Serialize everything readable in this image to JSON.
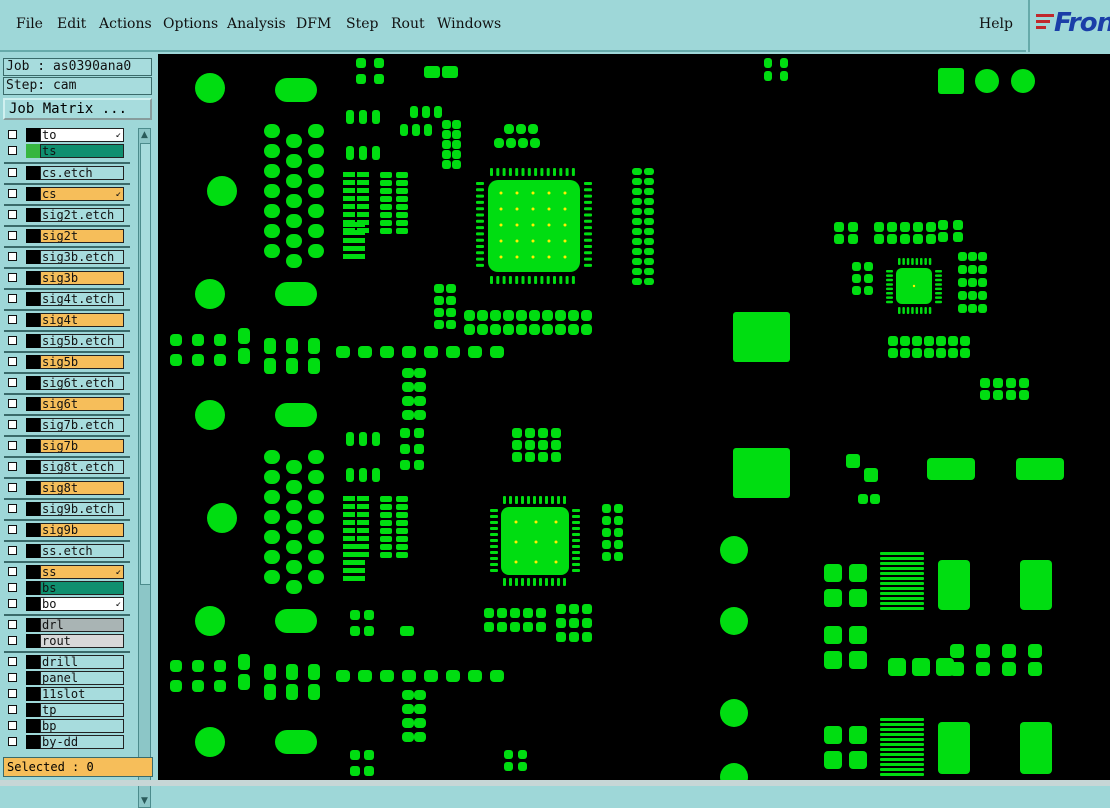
{
  "menu": {
    "items": [
      "File",
      "Edit",
      "Actions",
      "Options",
      "Analysis",
      "DFM",
      "Step",
      "Rout",
      "Windows"
    ],
    "help": "Help"
  },
  "logo": {
    "text": "Fron"
  },
  "info": {
    "job": "Job : as0390ana0",
    "step": "Step: cam"
  },
  "job_matrix_button": "Job Matrix ...",
  "layers": [
    {
      "name": "to",
      "color": "#ffffff",
      "swatch": "#000000",
      "arrow": true
    },
    {
      "name": "ts",
      "color": "#0f8f6f",
      "swatch": "#36b640",
      "arrow": false
    },
    {
      "name": "cs.etch",
      "color": "#a7dcdd",
      "swatch": "#000000",
      "arrow": false
    },
    {
      "name": "cs",
      "color": "#f6be5a",
      "swatch": "#000000",
      "arrow": true
    },
    {
      "name": "sig2t.etch",
      "color": "#a7dcdd",
      "swatch": "#000000",
      "arrow": false
    },
    {
      "name": "sig2t",
      "color": "#f6be5a",
      "swatch": "#000000",
      "arrow": false
    },
    {
      "name": "sig3b.etch",
      "color": "#a7dcdd",
      "swatch": "#000000",
      "arrow": false
    },
    {
      "name": "sig3b",
      "color": "#f6be5a",
      "swatch": "#000000",
      "arrow": false
    },
    {
      "name": "sig4t.etch",
      "color": "#a7dcdd",
      "swatch": "#000000",
      "arrow": false
    },
    {
      "name": "sig4t",
      "color": "#f6be5a",
      "swatch": "#000000",
      "arrow": false
    },
    {
      "name": "sig5b.etch",
      "color": "#a7dcdd",
      "swatch": "#000000",
      "arrow": false
    },
    {
      "name": "sig5b",
      "color": "#f6be5a",
      "swatch": "#000000",
      "arrow": false
    },
    {
      "name": "sig6t.etch",
      "color": "#a7dcdd",
      "swatch": "#000000",
      "arrow": false
    },
    {
      "name": "sig6t",
      "color": "#f6be5a",
      "swatch": "#000000",
      "arrow": false
    },
    {
      "name": "sig7b.etch",
      "color": "#a7dcdd",
      "swatch": "#000000",
      "arrow": false
    },
    {
      "name": "sig7b",
      "color": "#f6be5a",
      "swatch": "#000000",
      "arrow": false
    },
    {
      "name": "sig8t.etch",
      "color": "#a7dcdd",
      "swatch": "#000000",
      "arrow": false
    },
    {
      "name": "sig8t",
      "color": "#f6be5a",
      "swatch": "#000000",
      "arrow": false
    },
    {
      "name": "sig9b.etch",
      "color": "#a7dcdd",
      "swatch": "#000000",
      "arrow": false
    },
    {
      "name": "sig9b",
      "color": "#f6be5a",
      "swatch": "#000000",
      "arrow": false
    },
    {
      "name": "ss.etch",
      "color": "#a7dcdd",
      "swatch": "#000000",
      "arrow": false
    },
    {
      "name": "ss",
      "color": "#f6be5a",
      "swatch": "#000000",
      "arrow": true
    },
    {
      "name": "bs",
      "color": "#0f8f6f",
      "swatch": "#000000",
      "arrow": false
    },
    {
      "name": "bo",
      "color": "#ffffff",
      "swatch": "#000000",
      "arrow": true
    },
    {
      "name": "drl",
      "color": "#a9b4b4",
      "swatch": "#000000",
      "arrow": false
    },
    {
      "name": "rout",
      "color": "#d8d8d8",
      "swatch": "#000000",
      "arrow": false
    },
    {
      "name": "drill",
      "color": "#a7dcdd",
      "swatch": "#000000",
      "arrow": false
    },
    {
      "name": "panel",
      "color": "#a7dcdd",
      "swatch": "#000000",
      "arrow": false
    },
    {
      "name": "11slot",
      "color": "#a7dcdd",
      "swatch": "#000000",
      "arrow": false
    },
    {
      "name": "tp",
      "color": "#a7dcdd",
      "swatch": "#000000",
      "arrow": false
    },
    {
      "name": "bp",
      "color": "#a7dcdd",
      "swatch": "#000000",
      "arrow": false
    },
    {
      "name": "by-dd",
      "color": "#a7dcdd",
      "swatch": "#000000",
      "arrow": false
    }
  ],
  "selected": "Selected : 0",
  "canvas": {
    "background": "#000000",
    "pad_color": "#00dd11"
  }
}
